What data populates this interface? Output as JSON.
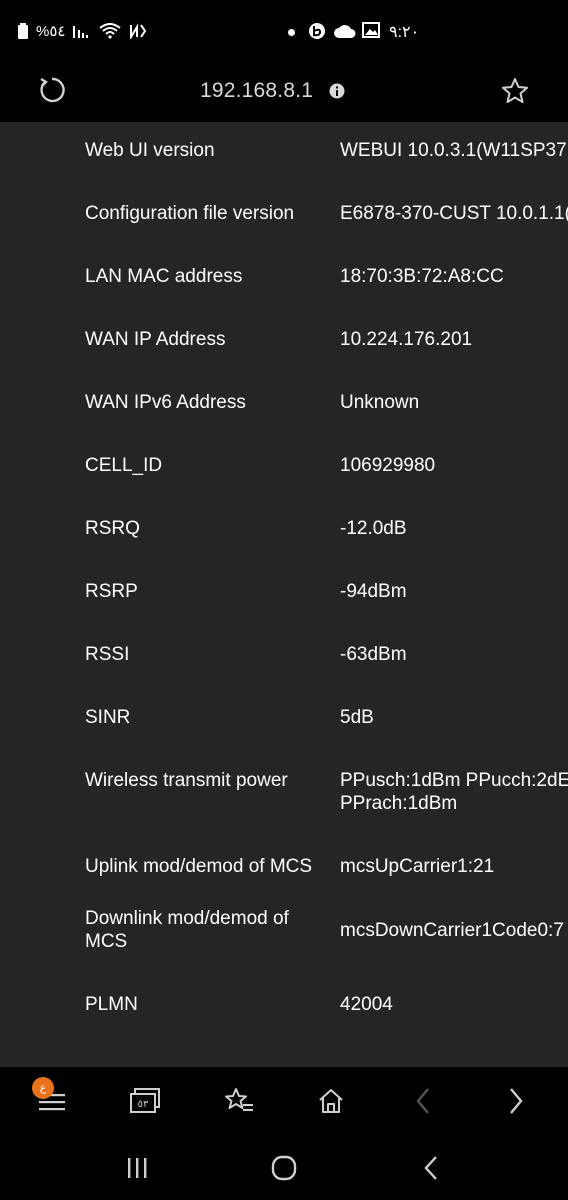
{
  "status_bar": {
    "battery_text": "%٥٤",
    "time": "٩:٢٠",
    "icons": [
      "battery-icon",
      "signal-icon",
      "wifi-icon",
      "nfc-icon",
      "dot-icon",
      "app-icon",
      "cloud-icon",
      "gallery-icon"
    ]
  },
  "browser": {
    "url": "192.168.8.1",
    "tab_count": "٥٣",
    "notification_badge": "ع"
  },
  "device_info": {
    "rows": [
      {
        "label": "Web UI version",
        "value": "WEBUI 10.0.3.1(W11SP37"
      },
      {
        "label": "Configuration file version",
        "value": "E6878-370-CUST 10.0.1.1("
      },
      {
        "label": "LAN MAC address",
        "value": "18:70:3B:72:A8:CC"
      },
      {
        "label": "WAN IP Address",
        "value": "10.224.176.201"
      },
      {
        "label": "WAN IPv6 Address",
        "value": "Unknown"
      },
      {
        "label": "CELL_ID",
        "value": "106929980"
      },
      {
        "label": "RSRQ",
        "value": "-12.0dB"
      },
      {
        "label": "RSRP",
        "value": "-94dBm"
      },
      {
        "label": "RSSI",
        "value": "-63dBm"
      },
      {
        "label": "SINR",
        "value": "5dB"
      },
      {
        "label": "Wireless transmit power",
        "value": "PPusch:1dBm PPucch:2dE",
        "value2": "PPrach:1dBm"
      },
      {
        "label": "Uplink mod/demod of MCS",
        "value": "mcsUpCarrier1:21"
      },
      {
        "label": "Downlink mod/demod of",
        "label2": "MCS",
        "value": "mcsDownCarrier1Code0:7"
      },
      {
        "label": "PLMN",
        "value": "42004"
      }
    ]
  }
}
